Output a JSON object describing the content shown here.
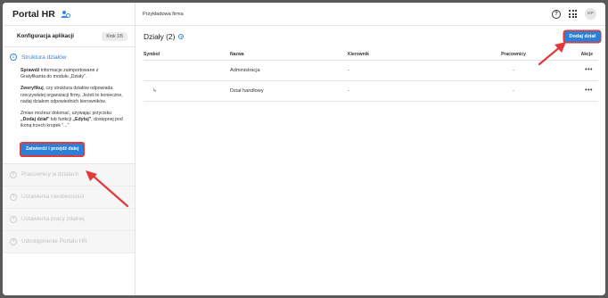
{
  "app": {
    "brand": "Portal HR",
    "company": "Przykładowa firma",
    "avatar_initials": "KP"
  },
  "sidebar": {
    "config_title": "Konfiguracja aplikacji",
    "step_badge": "Krok 1/5",
    "active_step": {
      "number": "1",
      "title": "Struktura działów",
      "p1_bold": "Sprawdź",
      "p1_rest": " informacje zaimportowane z Gratyfikanta do modułu „Działy\".",
      "p2_bold": "Zweryfikuj",
      "p2_rest": ", czy struktura działów odpowiada rzeczywistej organizacji firmy. Jeżeli to konieczne, nadaj działom odpowiednich kierowników.",
      "p3_a": "Zmian możesz dokonać, używając przycisku ",
      "p3_b1": "„Dodaj dział\"",
      "p3_c": " lub funkcji ",
      "p3_b2": "„Edytuj\"",
      "p3_d": ", dostępnej pod ikoną trzech kropek \"...\"",
      "button": "Zatwierdź i przejdź dalej"
    },
    "steps": [
      {
        "number": "2",
        "label": "Pracownicy w działach"
      },
      {
        "number": "3",
        "label": "Ustawienia nieobecności"
      },
      {
        "number": "4",
        "label": "Ustawienia pracy zdalnej"
      },
      {
        "number": "5",
        "label": "Udostępnienie Portalu HR"
      }
    ]
  },
  "main": {
    "title": "Działy (2)",
    "add_button": "Dodaj dział",
    "columns": [
      "Symbol",
      "Nazwa",
      "Kierownik",
      "Pracownicy",
      "Akcje"
    ],
    "rows": [
      {
        "symbol": "",
        "name": "Administracja",
        "manager": "-",
        "employees": "-",
        "actions": "•••"
      },
      {
        "symbol": "↳",
        "name": "Dział handlowy",
        "manager": "-",
        "employees": "-",
        "actions": "•••"
      }
    ]
  },
  "colors": {
    "accent": "#2e7fd6",
    "annotation": "#e23a3a"
  }
}
